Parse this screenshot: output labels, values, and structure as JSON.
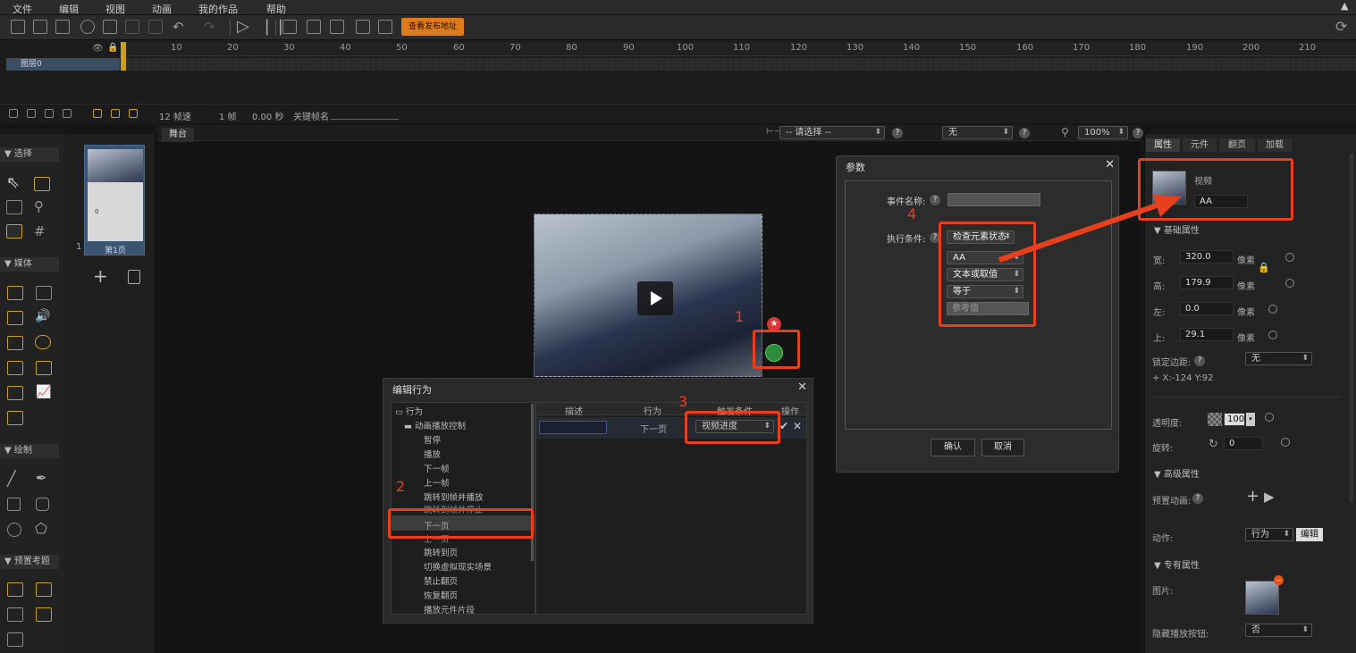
{
  "menu": {
    "items": [
      "文件",
      "编辑",
      "视图",
      "动画",
      "我的作品",
      "帮助"
    ]
  },
  "toolbar": {
    "publish_label": "查看发布地址"
  },
  "timeline": {
    "ruler_ticks": [
      "10",
      "20",
      "30",
      "40",
      "50",
      "60",
      "70",
      "80",
      "90",
      "100",
      "110",
      "120",
      "130",
      "140",
      "150",
      "160",
      "170",
      "180",
      "190",
      "200",
      "210"
    ],
    "layer_name": "图层0",
    "fps": "12 帧速",
    "frame": "1 帧",
    "time": "0.00 秒",
    "keyframe_label": "关键帧名"
  },
  "leftpanel": {
    "select": "▼ 选择",
    "media": "▼ 媒体",
    "draw": "▼ 绘制",
    "preset": "▼ 预置考题"
  },
  "pages": {
    "page_num": "1",
    "page_label": "第1页",
    "thumb_zero": "0"
  },
  "stage": {
    "tab": "舞台",
    "select_placeholder": "-- 请选择 --",
    "none_option": "无",
    "zoom": "100%"
  },
  "annotations": {
    "n1": "1",
    "n2": "2",
    "n3": "3",
    "n4": "4"
  },
  "edit_behavior": {
    "title": "编辑行为",
    "tree_root": "行为",
    "tree_group": "动画播放控制",
    "tree_items": [
      "暂停",
      "播放",
      "下一帧",
      "上一帧",
      "跳转到帧并播放",
      "跳转到帧并停止",
      "下一页",
      "上一页",
      "跳转到页",
      "切换虚拟现实场景",
      "禁止翻页",
      "恢复翻页",
      "播放元件片段"
    ],
    "columns": [
      "描述",
      "行为",
      "触发条件",
      "操作"
    ],
    "row": {
      "desc": "",
      "behavior": "下一页",
      "trigger": "视频进度"
    }
  },
  "params": {
    "title": "参数",
    "event_name_label": "事件名称:",
    "event_name_value": "",
    "condition_label": "执行条件:",
    "condition": "检查元素状态",
    "element": "AA",
    "value_type": "文本或取值",
    "operator": "等于",
    "ref_placeholder": "参考值",
    "ok": "确认",
    "cancel": "取消"
  },
  "rightpanel": {
    "tabs": [
      "属性",
      "元件",
      "翻页",
      "加载"
    ],
    "element_type": "视频",
    "element_name": "AA",
    "basic": "▼ 基础属性",
    "width_label": "宽:",
    "width": "320.0",
    "height_label": "高:",
    "height": "179.9",
    "left_label": "左:",
    "left": "0.0",
    "top_label": "上:",
    "top": "29.1",
    "unit": "像素",
    "lock_margin_label": "锁定边距:",
    "lock_margin": "无",
    "xy": "+  X:-124    Y:92",
    "opacity_label": "透明度:",
    "opacity": "100",
    "rotate_label": "旋转:",
    "rotate": "0",
    "advanced": "▼ 高级属性",
    "preset_anim_label": "预置动画:",
    "action_label": "动作:",
    "action_value": "行为",
    "edit_button": "编辑",
    "special": "▼ 专有属性",
    "image_label": "图片:",
    "hide_play_label": "隐藏播放按钮:",
    "hide_play_value": "否"
  },
  "colors": {
    "accent": "#e8401c",
    "publish": "#e07a1a",
    "layer": "#3a4d63"
  }
}
